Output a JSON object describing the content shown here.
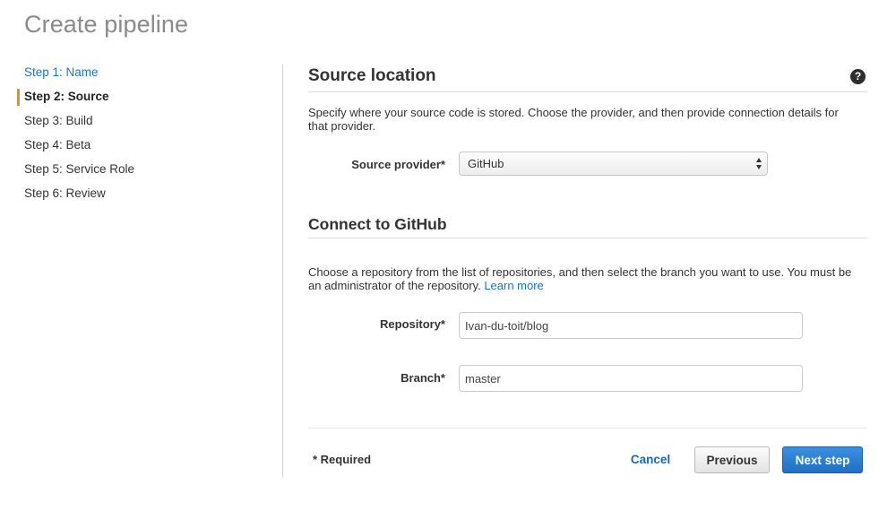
{
  "page": {
    "title": "Create pipeline"
  },
  "steps": [
    {
      "label": "Step 1: Name",
      "state": "link"
    },
    {
      "label": "Step 2: Source",
      "state": "active"
    },
    {
      "label": "Step 3: Build",
      "state": "normal"
    },
    {
      "label": "Step 4: Beta",
      "state": "normal"
    },
    {
      "label": "Step 5: Service Role",
      "state": "normal"
    },
    {
      "label": "Step 6: Review",
      "state": "normal"
    }
  ],
  "source_section": {
    "title": "Source location",
    "help_icon": "question-circle-icon",
    "help_glyph": "?",
    "description": "Specify where your source code is stored. Choose the provider, and then provide connection details for that provider.",
    "provider_label": "Source provider*",
    "provider_value": "GitHub"
  },
  "github_section": {
    "title": "Connect to GitHub",
    "description": "Choose a repository from the list of repositories, and then select the branch you want to use. You must be an administrator of the repository.",
    "learn_more": "Learn more",
    "repository_label": "Repository*",
    "repository_value": "Ivan-du-toit/blog",
    "branch_label": "Branch*",
    "branch_value": "master"
  },
  "footer": {
    "required_note": "* Required",
    "cancel_label": "Cancel",
    "previous_label": "Previous",
    "next_label": "Next step"
  },
  "colors": {
    "link": "#1a73c8",
    "active_step_marker": "#e88f1d",
    "primary_button": "#1f6fc4"
  }
}
